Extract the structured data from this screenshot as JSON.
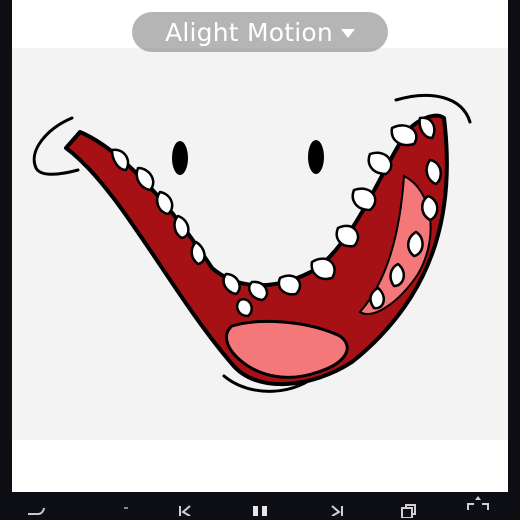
{
  "watermark": {
    "text": "Alight Motion",
    "icon": "chevron-down-icon"
  },
  "canvas": {
    "artwork": "cartoon-smiling-face",
    "colors": {
      "background": "#f3f3f3",
      "mouth": "#a51114",
      "tongue": "#f4777a",
      "teeth": "#ffffff",
      "outline": "#000000"
    }
  },
  "toolbar": {
    "icons": [
      "undo-icon",
      "skip-back-icon",
      "pause-icon",
      "skip-forward-icon",
      "duplicate-icon",
      "fullscreen-icon"
    ]
  }
}
